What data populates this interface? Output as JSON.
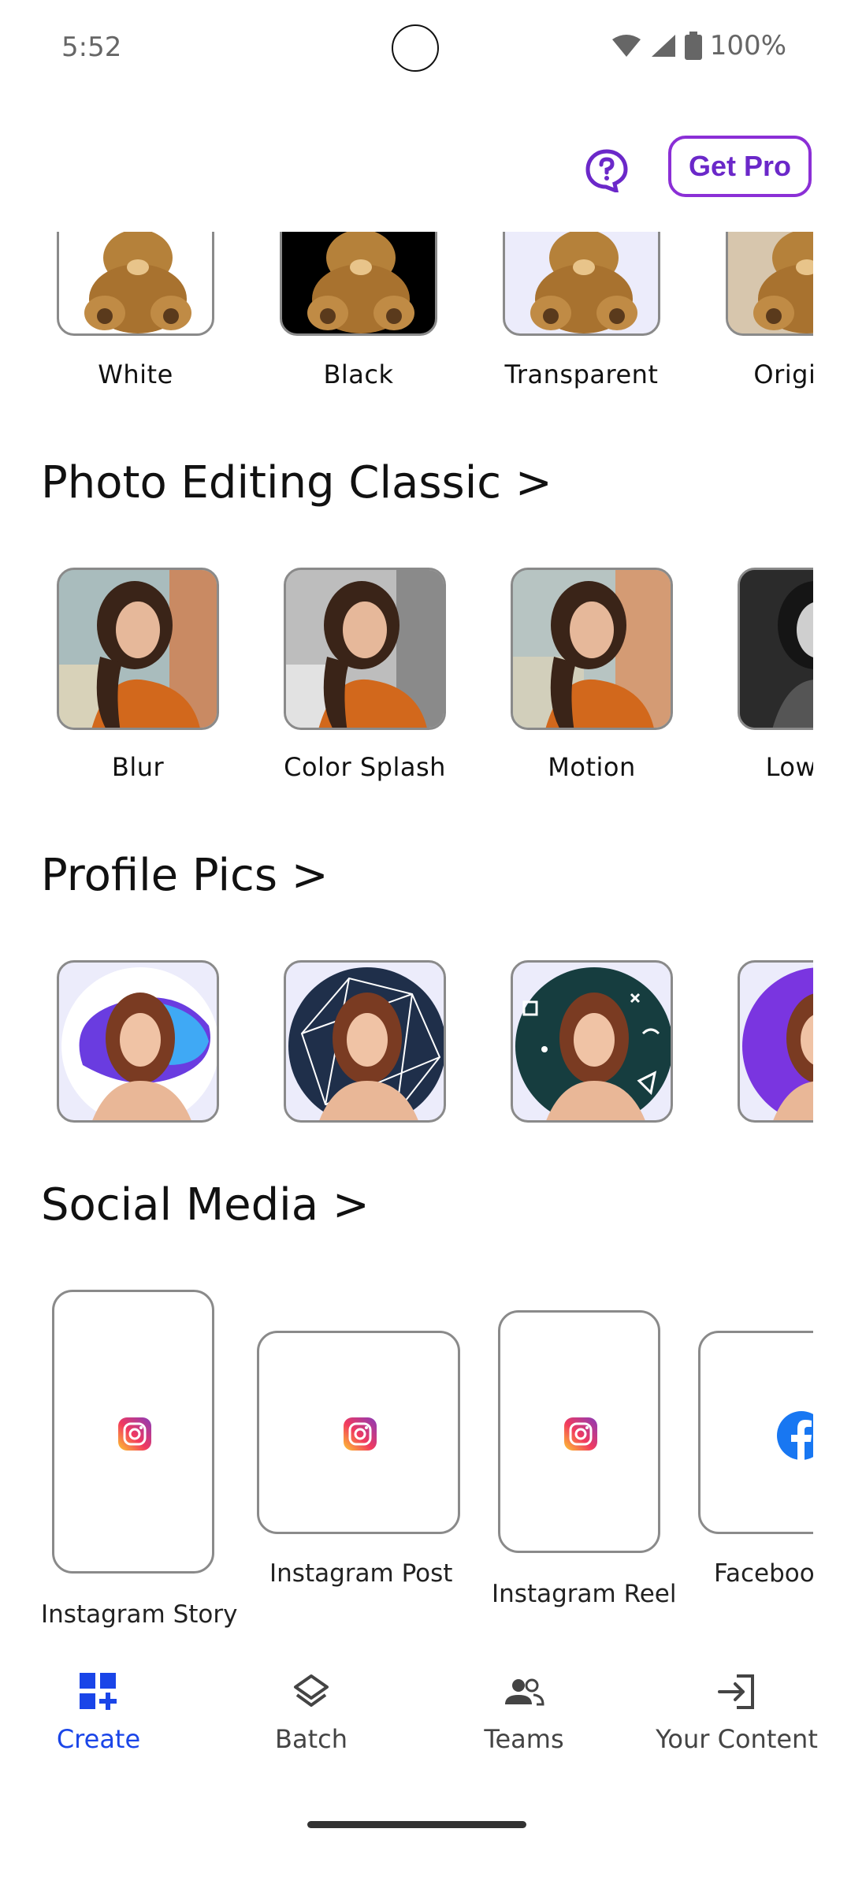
{
  "status": {
    "time": "5:52",
    "battery": "100%"
  },
  "header": {
    "get_pro": "Get Pro"
  },
  "backgrounds": {
    "items": [
      {
        "label": "White"
      },
      {
        "label": "Black"
      },
      {
        "label": "Transparent"
      },
      {
        "label": "Original"
      }
    ]
  },
  "photo_editing": {
    "title": "Photo Editing Classic  >",
    "items": [
      {
        "label": "Blur"
      },
      {
        "label": "Color Splash"
      },
      {
        "label": "Motion"
      },
      {
        "label": "Low Key"
      }
    ]
  },
  "profile_pics": {
    "title": "Profile Pics  >"
  },
  "social_media": {
    "title": "Social Media >",
    "items": [
      {
        "label": "Instagram Story"
      },
      {
        "label": "Instagram Post"
      },
      {
        "label": "Instagram Reel"
      },
      {
        "label": "Facebook"
      }
    ]
  },
  "nav": {
    "items": [
      {
        "label": "Create"
      },
      {
        "label": "Batch"
      },
      {
        "label": "Teams"
      },
      {
        "label": "Your Content"
      }
    ],
    "accent": "#1a45e8"
  }
}
